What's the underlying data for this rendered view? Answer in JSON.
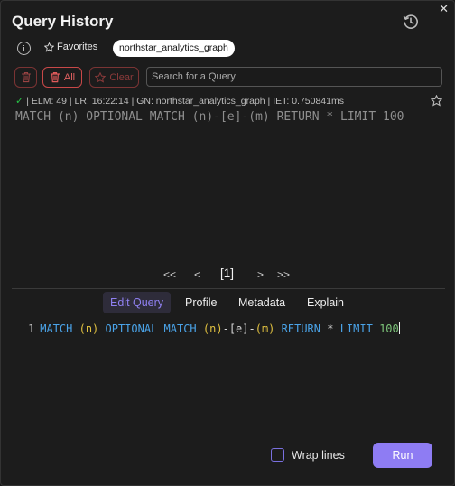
{
  "header": {
    "title": "Query History",
    "close_glyph": "✕",
    "history_icon": "history-clock-icon"
  },
  "toolbar": {
    "info_icon": "info-icon",
    "favorites_label": "Favorites",
    "graph_chip": "northstar_analytics_graph",
    "all_label": "All",
    "clear_label": "Clear",
    "search_placeholder": "Search for a Query"
  },
  "history": {
    "items": [
      {
        "status": "success",
        "meta": "| ELM: 49  |  LR: 16:22:14  |  GN: northstar_analytics_graph  |  IET: 0.750841ms",
        "query": "MATCH (n) OPTIONAL MATCH (n)-[e]-(m) RETURN * LIMIT 100"
      }
    ]
  },
  "pagination": {
    "first": "<<",
    "prev": "<",
    "current": "[1]",
    "next": ">",
    "last": ">>"
  },
  "tabs": {
    "edit_query": "Edit Query",
    "profile": "Profile",
    "metadata": "Metadata",
    "explain": "Explain"
  },
  "editor": {
    "line_number": "1",
    "tokens": {
      "match1": "MATCH",
      "n1": "(n)",
      "optional": "OPTIONAL MATCH",
      "n2": "(n)",
      "rel": "-[e]-",
      "m": "(m)",
      "return": "RETURN",
      "star": "*",
      "limit": "LIMIT",
      "num": "100"
    }
  },
  "footer": {
    "wrap_label": "Wrap lines",
    "run_label": "Run"
  },
  "colors": {
    "accent": "#8e7cf3",
    "danger": "#c84848",
    "success": "#27c046",
    "keyword": "#4aa3e8",
    "variable": "#e0c040",
    "number": "#7dc57a"
  }
}
